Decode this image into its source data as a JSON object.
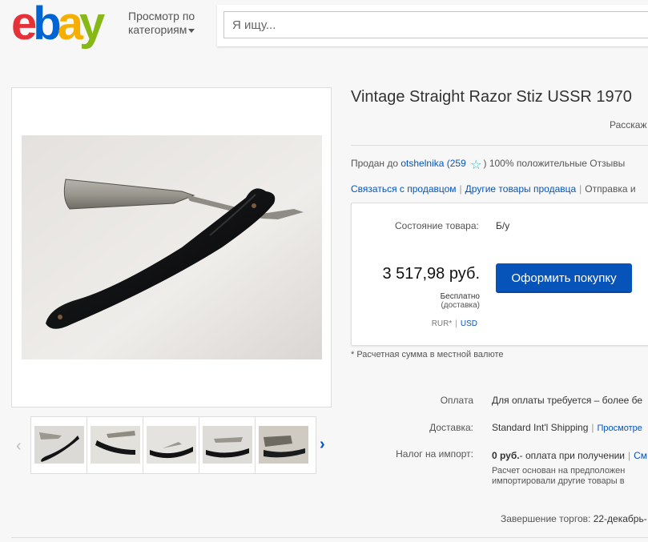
{
  "header": {
    "logo": {
      "e": "e",
      "b": "b",
      "a": "a",
      "y": "y"
    },
    "browse_line1": "Просмотр по",
    "browse_line2": "категориям",
    "search_placeholder": "Я ищу..."
  },
  "listing": {
    "title": "Vintage Straight Razor Stiz USSR 1970",
    "share_label": "Расскаж",
    "seller_prefix": "Продан до",
    "seller_name": "otshelnika",
    "seller_score": "(259",
    "seller_feedback": ") 100% положительные Отзывы",
    "contact_seller": "Связаться с продавцом",
    "other_items": "Другие товары продавца",
    "follow_seller": "Отправка и"
  },
  "buy_box": {
    "condition_label": "Состояние товара:",
    "condition_value": "Б/у",
    "price": "3 517,98 руб.",
    "shipping_line1": "Бесплатно",
    "shipping_line2": "(доставка)",
    "currency_rur": "RUR*",
    "currency_usd": "USD",
    "buy_button": "Оформить покупку"
  },
  "note": "* Расчетная сумма в местной валюте",
  "details": {
    "payment_label": "Оплата",
    "payment_value": "Для оплаты требуется – более бе",
    "delivery_label": "Доставка:",
    "delivery_value": "Standard Int'l Shipping",
    "delivery_link": "Просмотре",
    "import_label": "Налог на импорт:",
    "import_amount": "0 руб.",
    "import_value": "- оплата при получении",
    "import_link": "См",
    "import_note1": "Расчет основан на предположен",
    "import_note2": "импортировали другие товары в",
    "end_label": "Завершение торгов:",
    "end_value": "22-декабрь-"
  },
  "colors": {
    "accent": "#0654ba",
    "star": "#2ab7c9",
    "background": "#f7f7f7"
  },
  "icons": {
    "prev": "chevron-left-icon",
    "next": "chevron-right-icon",
    "star": "star-icon",
    "caret": "caret-down-icon"
  }
}
